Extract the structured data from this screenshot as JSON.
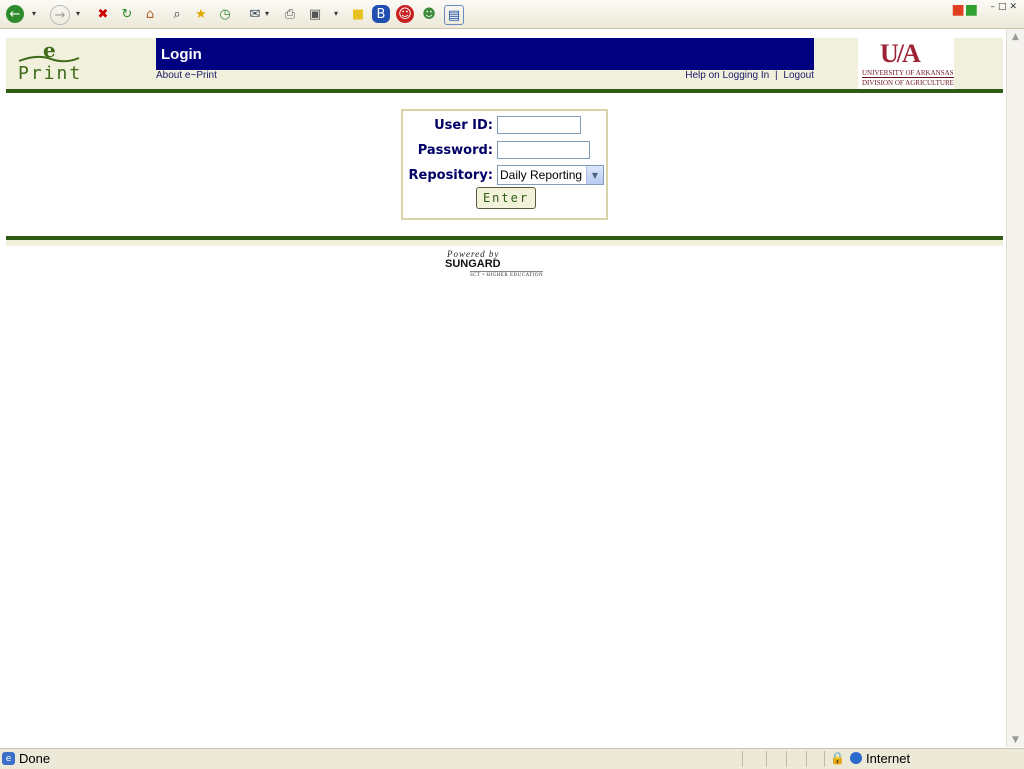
{
  "browser": {
    "toolbar_icons": [
      "back-icon",
      "forward-icon",
      "stop-icon",
      "refresh-icon",
      "home-icon",
      "search-icon",
      "favorites-icon",
      "history-icon",
      "mail-icon",
      "print-icon",
      "edit-icon",
      "note-icon",
      "bluetooth-icon",
      "messenger-icon",
      "people-icon",
      "fullscreen-icon"
    ],
    "status": "Done",
    "zone": "Internet"
  },
  "header": {
    "logo_e": "e",
    "logo_print": "Print",
    "title": "Login",
    "about_link": "About e~Print",
    "help_link": "Help on Logging In",
    "separator": "|",
    "logout_link": "Logout",
    "ua_mark": "U/A",
    "ua_line1": "UNIVERSITY OF ARKANSAS",
    "ua_line2": "DIVISION OF AGRICULTURE"
  },
  "login": {
    "user_id_label": "User ID:",
    "user_id_value": "",
    "password_label": "Password:",
    "password_value": "",
    "repository_label": "Repository:",
    "repository_value": "Daily Reporting",
    "enter_label": "Enter"
  },
  "footer": {
    "powered_by": "Powered by",
    "brand": "SUNGARD",
    "tagline": "SCT • HIGHER EDUCATION"
  },
  "colors": {
    "title_bar": "#000080",
    "rule_green": "#2f5c14",
    "header_bg": "#f0f0dc",
    "ua_red": "#9d2235"
  }
}
